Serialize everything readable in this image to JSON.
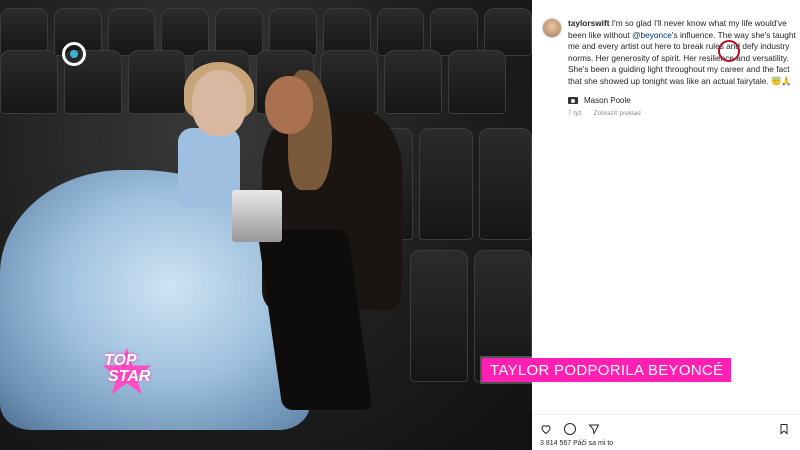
{
  "post": {
    "username": "taylorswift",
    "caption_part1": " I'm so glad I'll never know what my life would've been like without ",
    "mention": "@beyonce",
    "caption_part2": "'s influence. The way she's taught me and every artist out here to break rules and defy industry norms. Her generosity of spirit. Her resilience and versatility. She's been a guiding light throughout my career and the fact that she showed up tonight was like an actual fairytale.",
    "caption_emojis": "😇🙏",
    "location_label": "Mason Poole",
    "age": "7 týž.",
    "translate_label": "Zobraziť preklad",
    "likes_text": "3 814 567 Páči sa mi to"
  },
  "overlay": {
    "headline": "TAYLOR PODPORILA BEYONCÉ",
    "brand_line1": "TOP",
    "brand_line2": "STAR"
  },
  "icons": [
    "channel-logo-icon",
    "heart-icon",
    "comment-icon",
    "share-icon",
    "bookmark-icon",
    "camera-icon"
  ],
  "colors": {
    "banner": "#ff1fb3",
    "highlight_ring": "#b2102a",
    "mention": "#00376b"
  }
}
